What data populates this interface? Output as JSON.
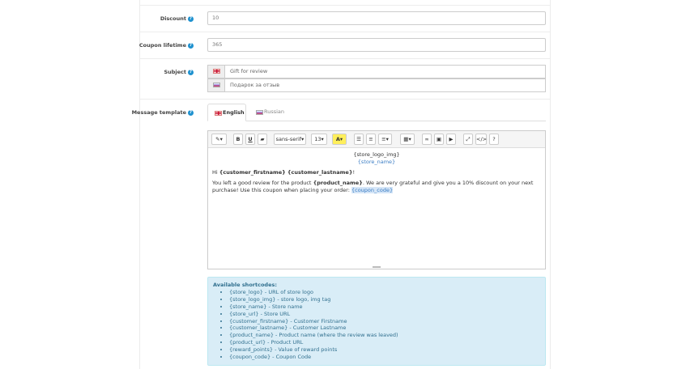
{
  "discount": {
    "label": "Discount",
    "value": "10"
  },
  "coupon_lifetime": {
    "label": "Coupon lifetime",
    "value": "365"
  },
  "subject": {
    "label": "Subject",
    "english_value": "Gift for review",
    "russian_value": "Подарок за отзыв"
  },
  "message_template": {
    "label": "Message template",
    "tabs": [
      {
        "label": "English"
      },
      {
        "label": "Russian"
      }
    ]
  },
  "toolbar": {
    "font_family": "sans-serif",
    "font_size": "13",
    "help": "?"
  },
  "editor": {
    "logo_placeholder": "{store_logo_img}",
    "store_name": "{store_name}",
    "greeting_prefix": "Hi ",
    "firstname": "{customer_firstname}",
    "lastname": "{customer_lastname}",
    "greeting_suffix": "!",
    "body_prefix": "You left a good review for the product ",
    "product_name": "{product_name}",
    "body_middle": ". We are very grateful and give you a 10% discount on your next purchase! Use this coupon when placing your order: ",
    "coupon_code": "{coupon_code}"
  },
  "shortcodes": {
    "title": "Available shortcodes:",
    "items": [
      "{store_logo} - URL of store logo",
      "{store_logo_img} - store logo, img tag",
      "{store_name} - Store name",
      "{store_url} - Store URL",
      "{customer_firstname} - Customer Firstname",
      "{customer_lastname} - Customer Lastname",
      "{product_name} - Product name (where the review was leaved)",
      "{product_url} - Product URL",
      "{reward_points} - Value of reward points",
      "{coupon_code} - Coupon Code"
    ]
  },
  "colors": {
    "help_icon": "#1e91cf",
    "alert_bg": "#d9edf7",
    "alert_text": "#31708f"
  }
}
